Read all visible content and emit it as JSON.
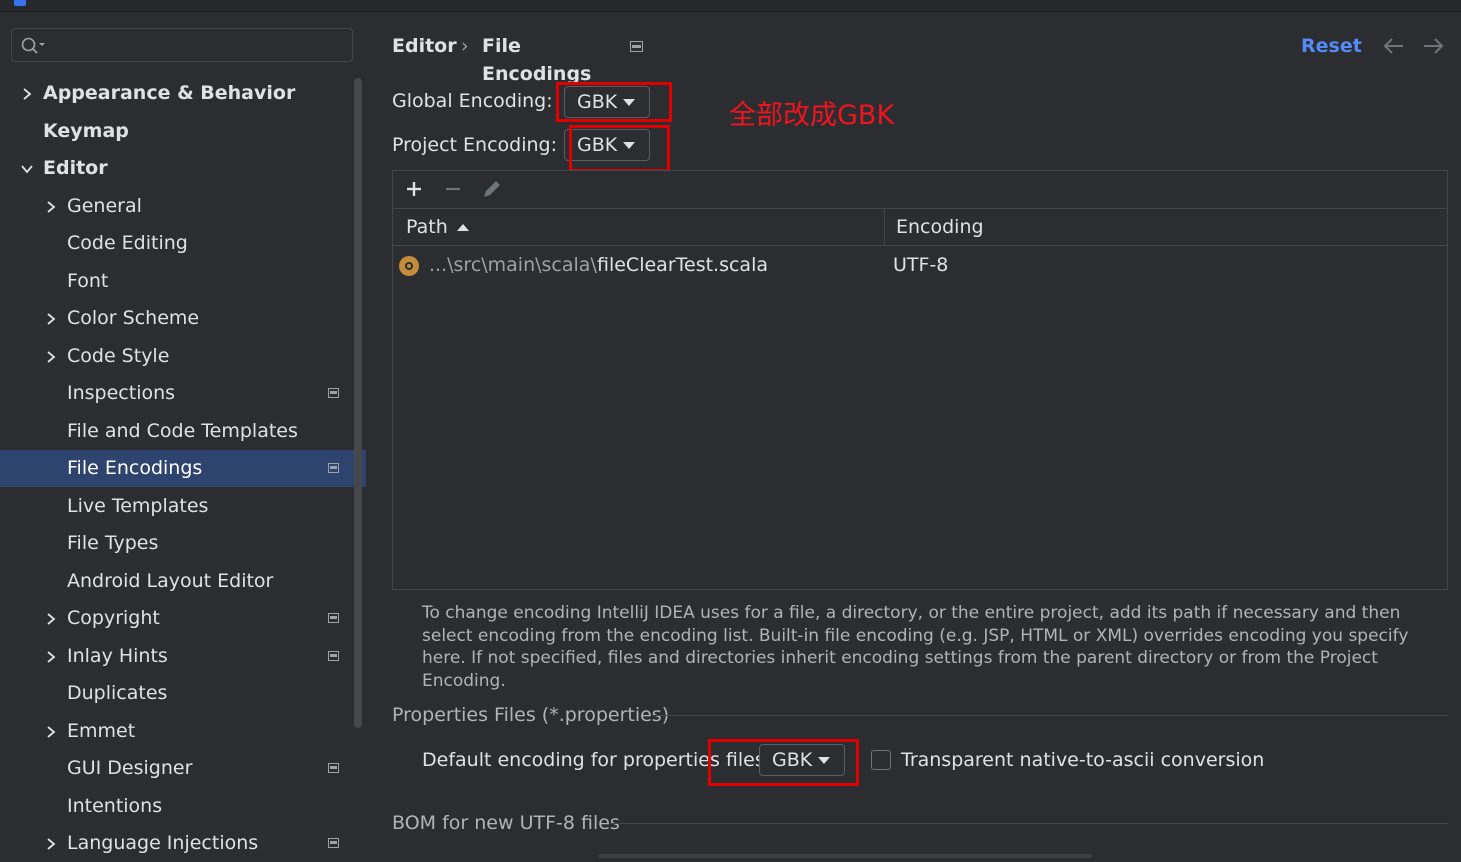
{
  "sidebar": {
    "search": {
      "placeholder": "",
      "value": ""
    },
    "items": [
      {
        "label": "Appearance & Behavior",
        "expandable": true,
        "expanded": false,
        "bold": true,
        "level": 0,
        "project_icon": false,
        "selected": false
      },
      {
        "label": "Keymap",
        "expandable": false,
        "bold": true,
        "level": 0,
        "project_icon": false,
        "selected": false
      },
      {
        "label": "Editor",
        "expandable": true,
        "expanded": true,
        "bold": true,
        "level": 0,
        "project_icon": false,
        "selected": false
      },
      {
        "label": "General",
        "expandable": true,
        "expanded": false,
        "bold": false,
        "level": 1,
        "project_icon": false,
        "selected": false
      },
      {
        "label": "Code Editing",
        "expandable": false,
        "bold": false,
        "level": 1,
        "project_icon": false,
        "selected": false
      },
      {
        "label": "Font",
        "expandable": false,
        "bold": false,
        "level": 1,
        "project_icon": false,
        "selected": false
      },
      {
        "label": "Color Scheme",
        "expandable": true,
        "expanded": false,
        "bold": false,
        "level": 1,
        "project_icon": false,
        "selected": false
      },
      {
        "label": "Code Style",
        "expandable": true,
        "expanded": false,
        "bold": false,
        "level": 1,
        "project_icon": false,
        "selected": false
      },
      {
        "label": "Inspections",
        "expandable": false,
        "bold": false,
        "level": 1,
        "project_icon": true,
        "selected": false
      },
      {
        "label": "File and Code Templates",
        "expandable": false,
        "bold": false,
        "level": 1,
        "project_icon": false,
        "selected": false
      },
      {
        "label": "File Encodings",
        "expandable": false,
        "bold": false,
        "level": 1,
        "project_icon": true,
        "selected": true
      },
      {
        "label": "Live Templates",
        "expandable": false,
        "bold": false,
        "level": 1,
        "project_icon": false,
        "selected": false
      },
      {
        "label": "File Types",
        "expandable": false,
        "bold": false,
        "level": 1,
        "project_icon": false,
        "selected": false
      },
      {
        "label": "Android Layout Editor",
        "expandable": false,
        "bold": false,
        "level": 1,
        "project_icon": false,
        "selected": false
      },
      {
        "label": "Copyright",
        "expandable": true,
        "expanded": false,
        "bold": false,
        "level": 1,
        "project_icon": true,
        "selected": false
      },
      {
        "label": "Inlay Hints",
        "expandable": true,
        "expanded": false,
        "bold": false,
        "level": 1,
        "project_icon": true,
        "selected": false
      },
      {
        "label": "Duplicates",
        "expandable": false,
        "bold": false,
        "level": 1,
        "project_icon": false,
        "selected": false
      },
      {
        "label": "Emmet",
        "expandable": true,
        "expanded": false,
        "bold": false,
        "level": 1,
        "project_icon": false,
        "selected": false
      },
      {
        "label": "GUI Designer",
        "expandable": false,
        "bold": false,
        "level": 1,
        "project_icon": true,
        "selected": false
      },
      {
        "label": "Intentions",
        "expandable": false,
        "bold": false,
        "level": 1,
        "project_icon": false,
        "selected": false
      },
      {
        "label": "Language Injections",
        "expandable": true,
        "expanded": false,
        "bold": false,
        "level": 1,
        "project_icon": true,
        "selected": false
      }
    ]
  },
  "header": {
    "breadcrumb": [
      "Editor",
      "File Encodings"
    ],
    "separator": "›",
    "reset_label": "Reset"
  },
  "encodings": {
    "global_label": "Global Encoding:",
    "global_value": "GBK",
    "project_label": "Project Encoding:",
    "project_value": "GBK"
  },
  "annotation": {
    "text": "全部改成GBK",
    "color": "#f0141e"
  },
  "table": {
    "columns": [
      "Path",
      "Encoding"
    ],
    "rows": [
      {
        "path_prefix": "...\\src\\main\\scala\\",
        "path_file": "fileClearTest.scala",
        "encoding": "UTF-8"
      }
    ]
  },
  "help_text": "To change encoding IntelliJ IDEA uses for a file, a directory, or the entire project, add its path if necessary and then select encoding from the encoding list. Built-in file encoding (e.g. JSP, HTML or XML) overrides encoding you specify here. If not specified, files and directories inherit encoding settings from the parent directory or from the Project Encoding.",
  "properties": {
    "section_title": "Properties Files (*.properties)",
    "default_label": "Default encoding for properties files:",
    "default_value": "GBK",
    "transparent_label": "Transparent native-to-ascii conversion",
    "transparent_checked": false
  },
  "bom": {
    "section_title": "BOM for new UTF-8 files"
  },
  "colors": {
    "background": "#2b2d30",
    "selection": "#2e436e",
    "accent": "#548af7",
    "highlight_box": "#e00000"
  }
}
